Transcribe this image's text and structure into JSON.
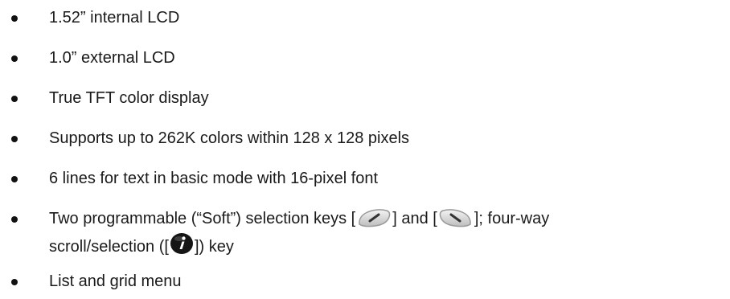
{
  "bullets": [
    {
      "text": "1.52” internal LCD"
    },
    {
      "text": "1.0” external LCD"
    },
    {
      "text": "True TFT color display"
    },
    {
      "text": "Supports up to 262K colors within 128 x 128 pixels"
    },
    {
      "text": "6 lines for text in basic mode with 16-pixel font"
    },
    {
      "part1": "Two programmable (“Soft”) selection keys [",
      "part2": "] and [",
      "part3": "]; four-way",
      "line2_part1": "scroll/selection ([",
      "line2_part2": "]) key"
    },
    {
      "text": "List and grid menu"
    }
  ],
  "icons": {
    "left_soft_key": "left-soft-key-icon",
    "right_soft_key": "right-soft-key-icon",
    "navigation_key": "info-nav-key-icon"
  }
}
